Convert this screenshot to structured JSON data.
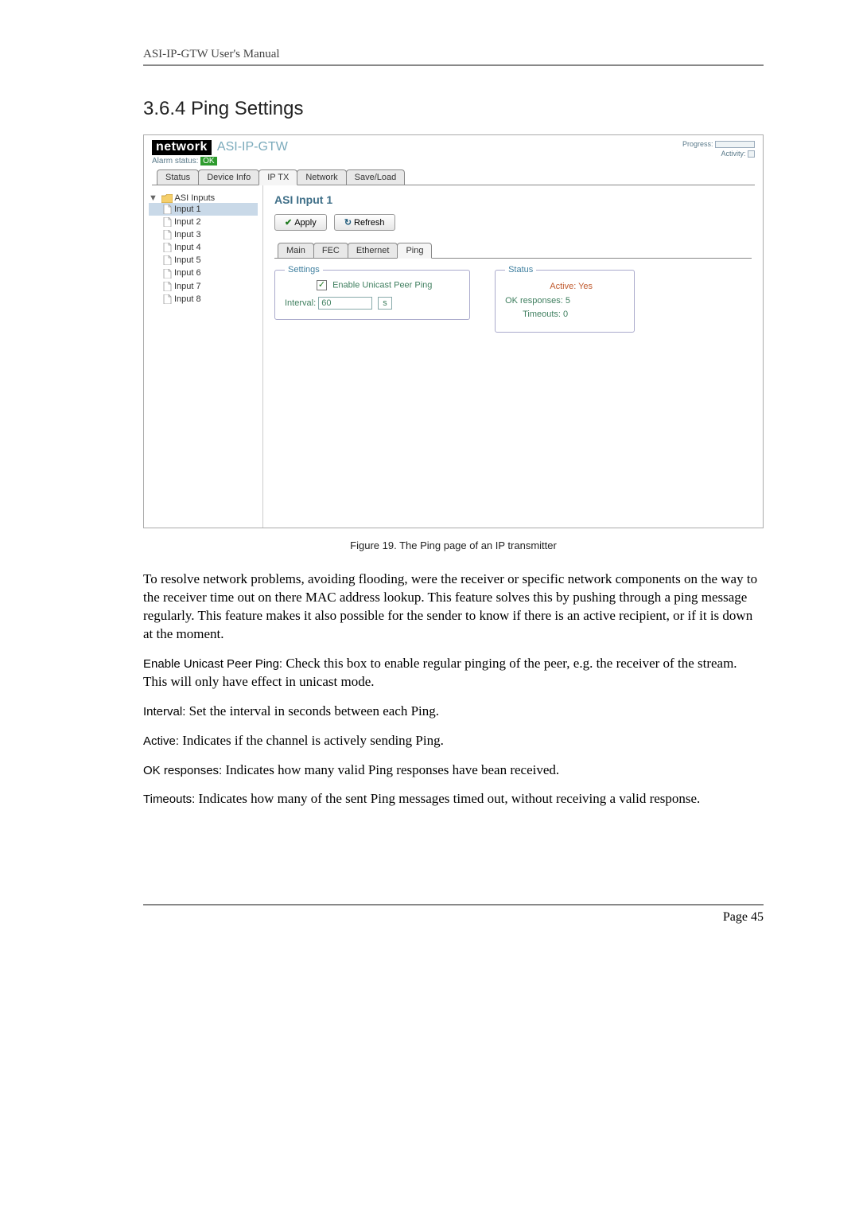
{
  "doc": {
    "header": "ASI-IP-GTW User's Manual",
    "section_title": "3.6.4 Ping Settings",
    "caption": "Figure 19. The Ping page of an IP transmitter",
    "page_label": "Page 45"
  },
  "screenshot": {
    "brand": "network",
    "product": "ASI-IP-GTW",
    "progress_label": "Progress:",
    "activity_label": "Activity:",
    "alarm_label": "Alarm status:",
    "alarm_value": "OK",
    "tabs": [
      "Status",
      "Device Info",
      "IP TX",
      "Network",
      "Save/Load"
    ],
    "active_tab_index": 2,
    "tree_root": "ASI Inputs",
    "tree_items": [
      "Input 1",
      "Input 2",
      "Input 3",
      "Input 4",
      "Input 5",
      "Input 6",
      "Input 7",
      "Input 8"
    ],
    "tree_selected_index": 0,
    "panel_title": "ASI Input 1",
    "apply_label": "Apply",
    "refresh_label": "Refresh",
    "inner_tabs": [
      "Main",
      "FEC",
      "Ethernet",
      "Ping"
    ],
    "inner_active_index": 3,
    "settings_legend": "Settings",
    "enable_label": "Enable Unicast Peer Ping",
    "enable_checked": true,
    "interval_label": "Interval:",
    "interval_value": "60",
    "interval_unit": "s",
    "status_legend": "Status",
    "status_active_label": "Active:",
    "status_active_value": "Yes",
    "status_ok_label": "OK responses:",
    "status_ok_value": "5",
    "status_to_label": "Timeouts:",
    "status_to_value": "0"
  },
  "paragraphs": {
    "p1": "To resolve network problems, avoiding flooding, were the receiver or specific network components on the way to the receiver time out on there MAC address lookup. This feature solves this by pushing through a ping message regularly. This feature makes it also possible for the sender to know if there is an active recipient, or if it is down at the moment.",
    "enable_term": "Enable Unicast Peer Ping:",
    "enable_text": " Check this box to enable regular pinging of the peer, e.g. the receiver of the stream. This will only have effect in unicast mode.",
    "interval_term": "Interval:",
    "interval_text": "  Set the interval in seconds between each Ping.",
    "active_term": "Active:",
    "active_text": " Indicates if the channel is actively sending Ping.",
    "okresp_term": "OK responses:",
    "okresp_text": " Indicates how many valid Ping responses have bean received.",
    "timeouts_term": "Timeouts:",
    "timeouts_text": " Indicates how many of the sent Ping messages timed out, without receiving a valid response."
  }
}
